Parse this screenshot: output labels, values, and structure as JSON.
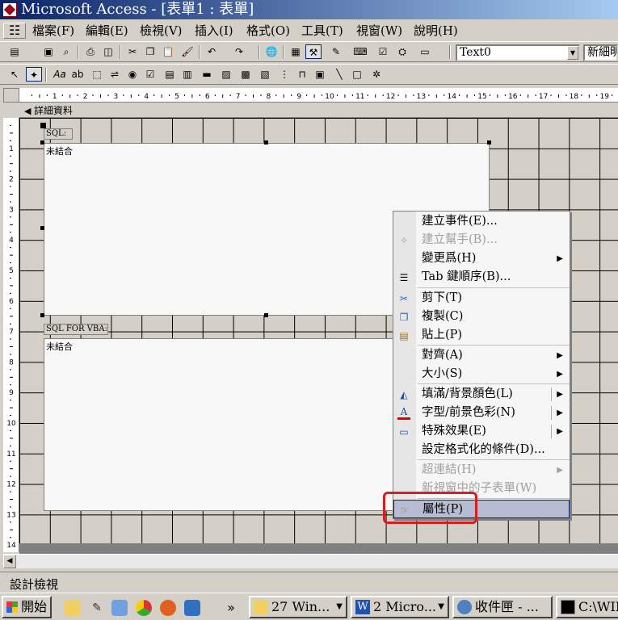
{
  "window": {
    "title": "Microsoft Access - [表單1 : 表單]"
  },
  "menu": {
    "items": [
      "檔案(F)",
      "編輯(E)",
      "檢視(V)",
      "插入(I)",
      "格式(O)",
      "工具(T)",
      "視窗(W)",
      "說明(H)"
    ]
  },
  "toolbar": {
    "object_combo": "Text0",
    "font_combo": "新細明"
  },
  "ruler": {
    "ticks": [
      "1",
      "2",
      "3",
      "4",
      "5",
      "6",
      "7",
      "8",
      "9",
      "10",
      "11",
      "12",
      "13",
      "14",
      "15",
      "16",
      "17",
      "18",
      "19"
    ],
    "vticks": [
      "1",
      "2",
      "3",
      "4",
      "5",
      "6",
      "7",
      "8",
      "9",
      "10",
      "11",
      "12",
      "13",
      "14"
    ]
  },
  "form": {
    "section_label": "詳細資料",
    "controls": [
      {
        "label": "SQL:",
        "value": "未結合"
      },
      {
        "label": "SQL FOR VBA:",
        "value": "未結合"
      }
    ]
  },
  "context_menu": {
    "items": [
      {
        "label": "建立事件(E)...",
        "icon": "",
        "disabled": false,
        "submenu": false
      },
      {
        "label": "建立幫手(B)...",
        "icon": "wizard-icon",
        "disabled": true,
        "submenu": false
      },
      {
        "label": "變更爲(H)",
        "icon": "",
        "disabled": false,
        "submenu": true
      },
      {
        "label": "Tab 鍵順序(B)...",
        "icon": "tab-order-icon",
        "disabled": false,
        "submenu": false
      },
      {
        "label": "剪下(T)",
        "icon": "cut-icon",
        "disabled": false,
        "submenu": false
      },
      {
        "label": "複製(C)",
        "icon": "copy-icon",
        "disabled": false,
        "submenu": false
      },
      {
        "label": "貼上(P)",
        "icon": "paste-icon",
        "disabled": false,
        "submenu": false
      },
      {
        "label": "對齊(A)",
        "icon": "",
        "disabled": false,
        "submenu": true
      },
      {
        "label": "大小(S)",
        "icon": "",
        "disabled": false,
        "submenu": true
      },
      {
        "label": "填滿/背景顏色(L)",
        "icon": "fill-color-icon",
        "disabled": false,
        "submenu": true
      },
      {
        "label": "字型/前景色彩(N)",
        "icon": "font-color-icon",
        "disabled": false,
        "submenu": true
      },
      {
        "label": "特殊效果(E)",
        "icon": "special-effect-icon",
        "disabled": false,
        "submenu": true
      },
      {
        "label": "設定格式化的條件(D)...",
        "icon": "",
        "disabled": false,
        "submenu": false
      },
      {
        "label": "超連結(H)",
        "icon": "",
        "disabled": true,
        "submenu": true
      },
      {
        "label": "新視窗中的子表單(W)",
        "icon": "",
        "disabled": true,
        "submenu": false
      },
      {
        "label": "屬性(P)",
        "icon": "properties-icon",
        "disabled": false,
        "submenu": false,
        "highlighted": true
      }
    ]
  },
  "status": {
    "text": "設計檢視"
  },
  "taskbar": {
    "start_label": "開始",
    "overflow": "»",
    "tasks": [
      {
        "label": "27 Win...",
        "icon": "folder-icon"
      },
      {
        "label": "2 Micro...",
        "icon": "word-icon"
      },
      {
        "label": "收件匣 - ...",
        "icon": "outlook-icon"
      },
      {
        "label": "C:\\WIN",
        "icon": "cmd-icon"
      }
    ]
  },
  "colors": {
    "titlebar": "#0a246a",
    "highlight": "#b6bdd2",
    "annotation": "#d42020"
  }
}
